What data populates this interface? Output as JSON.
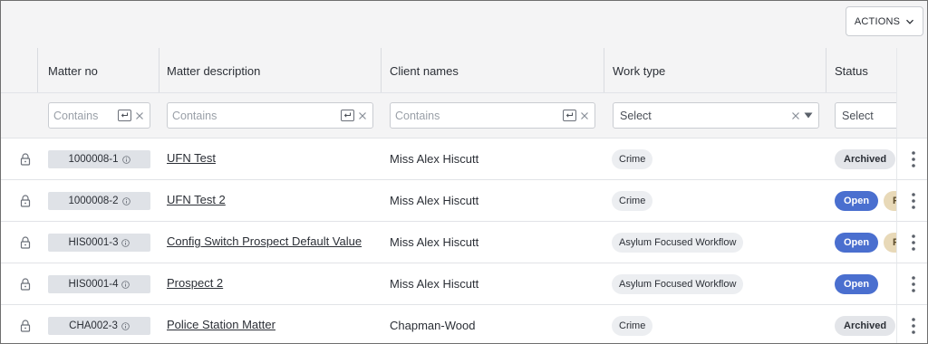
{
  "toolbar": {
    "actions_label": "ACTIONS"
  },
  "columns": {
    "matter_no": "Matter no",
    "matter_description": "Matter description",
    "client_names": "Client names",
    "work_type": "Work type",
    "status": "Status"
  },
  "filters": {
    "matter_no_placeholder": "Contains",
    "description_placeholder": "Contains",
    "client_placeholder": "Contains",
    "work_type_placeholder": "Select",
    "status_placeholder": "Select"
  },
  "rows": [
    {
      "matter_no": "1000008-1",
      "description": "UFN Test",
      "client": "Miss Alex Hiscutt",
      "work_type": "Crime",
      "status": "Archived",
      "extra": ""
    },
    {
      "matter_no": "1000008-2",
      "description": "UFN Test 2",
      "client": "Miss Alex Hiscutt",
      "work_type": "Crime",
      "status": "Open",
      "extra": "F"
    },
    {
      "matter_no": "HIS0001-3",
      "description": "Config Switch Prospect Default Value",
      "client": "Miss Alex Hiscutt",
      "work_type": "Asylum Focused Workflow",
      "status": "Open",
      "extra": "F"
    },
    {
      "matter_no": "HIS0001-4",
      "description": "Prospect 2",
      "client": "Miss Alex Hiscutt",
      "work_type": "Asylum Focused Workflow",
      "status": "Open",
      "extra": ""
    },
    {
      "matter_no": "CHA002-3",
      "description": "Police Station Matter",
      "client": "Chapman-Wood",
      "work_type": "Crime",
      "status": "Archived",
      "extra": ""
    }
  ],
  "colors": {
    "open_status": "#4a6fcf",
    "archived_status": "#e3e5e9",
    "pending_chip": "#e8d9b8"
  }
}
